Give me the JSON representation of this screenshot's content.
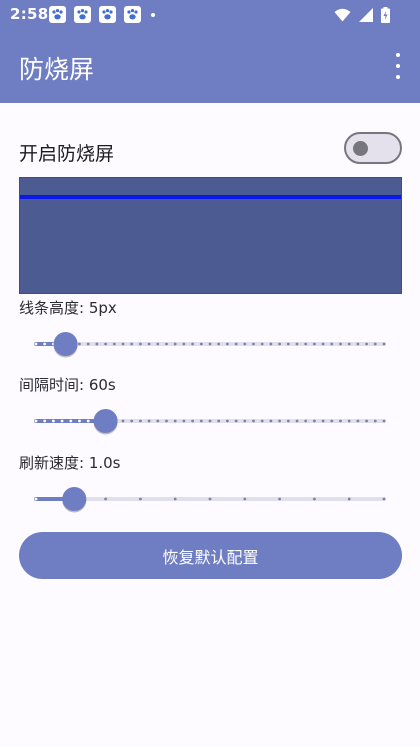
{
  "status": {
    "time": "2:58",
    "notification_icons": [
      "paw-icon",
      "paw-icon",
      "paw-icon",
      "paw-icon"
    ]
  },
  "app_bar": {
    "title": "防烧屏",
    "menu_icon": "more-vert-icon"
  },
  "settings": {
    "enable_label": "开启防烧屏",
    "enable_on": false,
    "preview_line_color": "#0a19e3",
    "preview_bg_color": "#4c5b92",
    "accent_color": "#6f7dc3",
    "sliders": [
      {
        "label": "线条高度: 5px",
        "fraction": 0.085,
        "ticks": 40
      },
      {
        "label": "间隔时间: 60s",
        "fraction": 0.2,
        "ticks": 40
      },
      {
        "label": "刷新速度: 1.0s",
        "fraction": 0.11,
        "ticks": 10
      }
    ],
    "reset_label": "恢复默认配置"
  }
}
